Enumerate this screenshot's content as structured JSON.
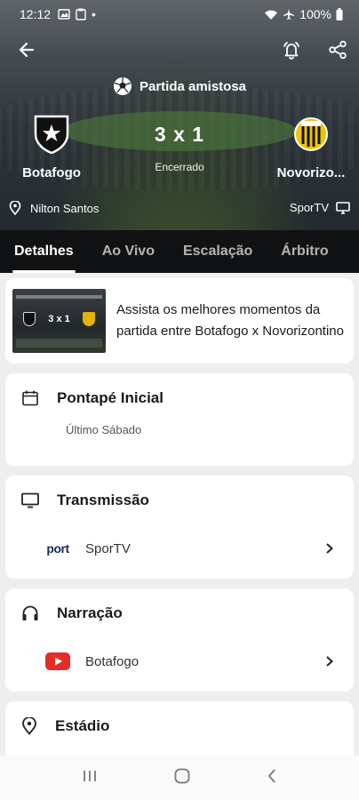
{
  "status_bar": {
    "time": "12:12",
    "battery": "100%"
  },
  "match": {
    "type": "Partida amistosa",
    "home_team": "Botafogo",
    "away_team": "Novorizo...",
    "score": "3 x 1",
    "status": "Encerrado",
    "venue": "Nilton Santos",
    "broadcaster": "SporTV"
  },
  "tabs": [
    "Detalhes",
    "Ao Vivo",
    "Escalação",
    "Árbitro"
  ],
  "highlight": {
    "text": "Assista os melhores momentos da partida entre Botafogo x Novorizontino",
    "thumb_score": "3 x 1"
  },
  "kickoff": {
    "title": "Pontapé Inicial",
    "value": "Último Sábado"
  },
  "transmission": {
    "title": "Transmissão",
    "channel_logo_text": "port",
    "channel": "SporTV"
  },
  "narration": {
    "title": "Narração",
    "channel": "Botafogo"
  },
  "stadium": {
    "title": "Estádio"
  },
  "colors": {
    "tab_bar": "#111214",
    "youtube_red": "#e52d27",
    "background": "#eeeeef"
  }
}
